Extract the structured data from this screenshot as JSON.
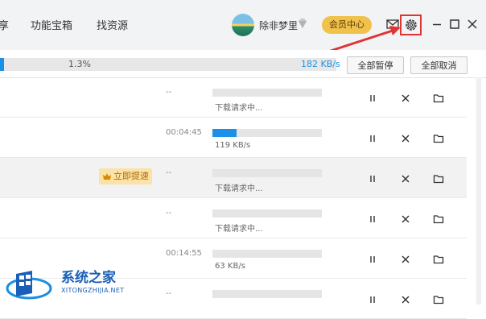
{
  "nav": [
    "享",
    "功能宝箱",
    "找资源"
  ],
  "user": {
    "name": "除非梦里",
    "vip_label": "会员中心"
  },
  "icons": {
    "mail": "mail-icon",
    "settings": "gear-icon",
    "minimize": "minimize-icon",
    "maximize": "maximize-icon",
    "close": "close-icon",
    "pause": "pause-icon",
    "cancel": "x-icon",
    "folder": "folder-icon",
    "crown": "crown-icon",
    "diamond": "diamond-icon"
  },
  "colors": {
    "accent": "#1a90e8",
    "vip": "#f0c24b",
    "highlight": "#e03434",
    "boost_bg": "#fbe3a8"
  },
  "status_bar": {
    "progress_text": "1.3%",
    "progress": 0.013,
    "speed": "182 KB/s",
    "pause_all": "全部暂停",
    "cancel_all": "全部取消"
  },
  "downloads": [
    {
      "elapsed": "--",
      "progress": 0,
      "status": "下载请求中...",
      "boost": ""
    },
    {
      "elapsed": "00:04:45",
      "progress": 0.22,
      "status": "119 KB/s",
      "boost": ""
    },
    {
      "elapsed": "--",
      "progress": 0,
      "status": "下载请求中...",
      "boost": "立即提速"
    },
    {
      "elapsed": "--",
      "progress": 0,
      "status": "下载请求中...",
      "boost": ""
    },
    {
      "elapsed": "00:14:55",
      "progress": 0,
      "status": "63 KB/s",
      "boost": ""
    },
    {
      "elapsed": "--",
      "progress": 0,
      "status": "",
      "boost": ""
    }
  ],
  "watermark": {
    "name": "系统之家",
    "url": "XITONGZHIJIA.NET"
  }
}
